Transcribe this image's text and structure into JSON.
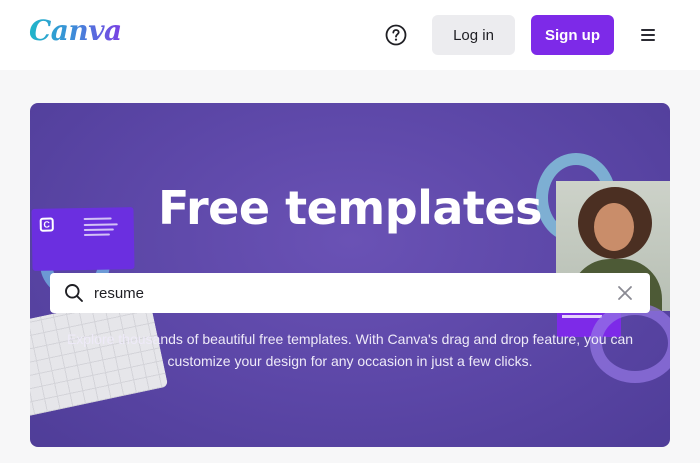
{
  "header": {
    "logo": "Canva",
    "help_icon": "question-circle-icon",
    "login_label": "Log in",
    "signup_label": "Sign up",
    "menu_icon": "hamburger-menu-icon"
  },
  "hero": {
    "title": "Free templates",
    "search": {
      "value": "resume",
      "search_icon": "search-icon",
      "clear_icon": "close-icon"
    },
    "description": "Explore thousands of beautiful free templates. With Canva's drag and drop feature, you can customize your design for any occasion in just a few clicks."
  },
  "colors": {
    "brand_purple": "#7d2ae8",
    "hero_bg": "#5b46a6",
    "logo_gradient_start": "#1fb6c9",
    "logo_gradient_end": "#7b3fe4"
  }
}
